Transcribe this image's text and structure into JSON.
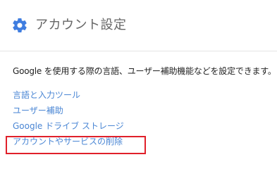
{
  "header": {
    "icon": "gear-icon",
    "title": "アカウント設定"
  },
  "description": "Google を使用する際の言語、ユーザー補助機能などを設定できます。",
  "links": [
    {
      "label": "言語と入力ツール"
    },
    {
      "label": "ユーザー補助"
    },
    {
      "label": "Google ドライブ ストレージ"
    },
    {
      "label": "アカウントやサービスの削除"
    }
  ],
  "colors": {
    "gear": "#3f7de0",
    "link": "#4a86d4",
    "highlight_box": "#e0202a"
  }
}
